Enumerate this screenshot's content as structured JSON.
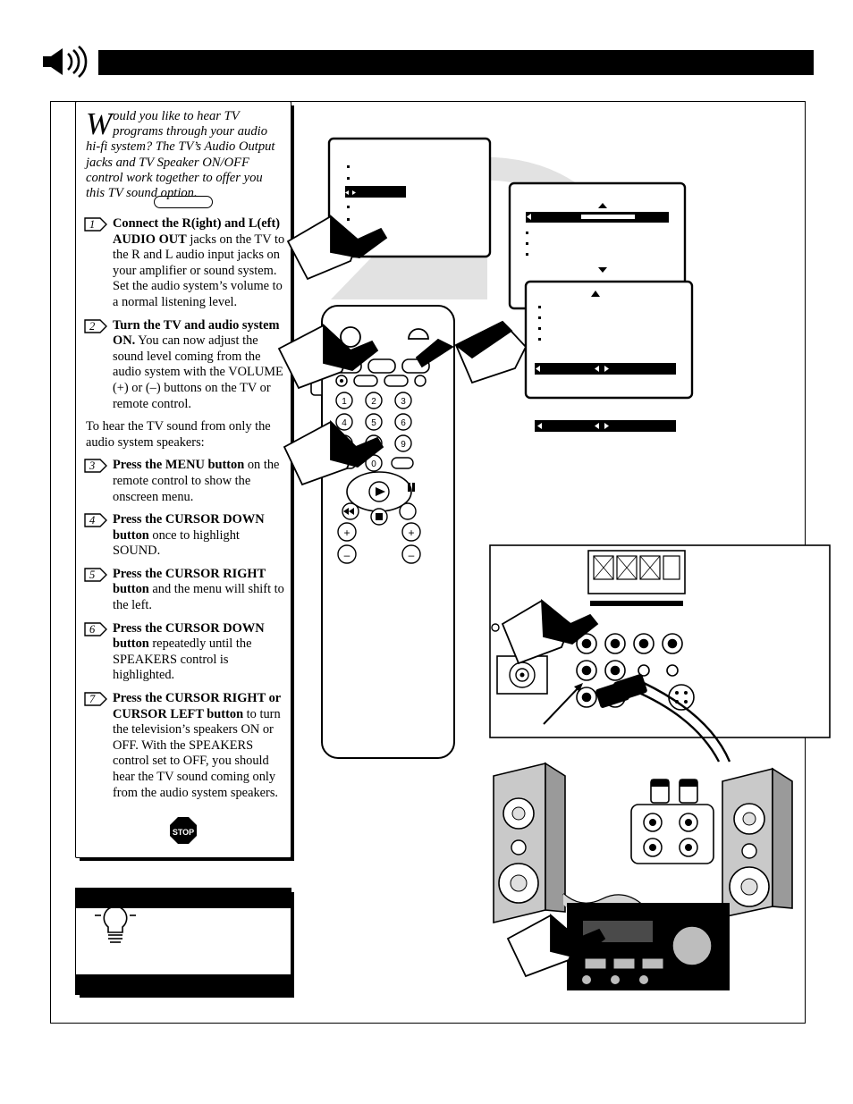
{
  "header": {
    "icon": "speaker-mute-icon",
    "bar_color": "#000000",
    "title": ""
  },
  "intro": {
    "dropcap": "W",
    "text": "ould you like to hear TV programs through your audio hi-fi system?  The TV’s Audio Output jacks and TV Speaker ON/OFF control work together to offer you this TV sound option."
  },
  "steps": [
    {
      "number": "1",
      "bold": "Connect the R(ight) and L(eft) AUDIO OUT",
      "rest": " jacks on the TV to the R and L audio input jacks on your amplifier or sound system.  Set the audio system’s volume to a normal listening level."
    },
    {
      "number": "2",
      "bold": "Turn the TV and audio system ON.",
      "rest": " You can now adjust the sound level coming from the audio system with the VOLUME (+) or (–) buttons on the TV or remote control."
    },
    {
      "number": "3",
      "bold": "Press the MENU button",
      "rest": " on the remote control to show the onscreen menu."
    },
    {
      "number": "4",
      "bold": "Press the CURSOR DOWN button",
      "rest": " once to highlight SOUND."
    },
    {
      "number": "5",
      "bold": "Press the CURSOR RIGHT button",
      "rest": " and the menu will shift to the left."
    },
    {
      "number": "6",
      "bold": "Press the CURSOR DOWN button",
      "rest": " repeatedly until the SPEAKERS control is highlighted."
    },
    {
      "number": "7",
      "bold": "Press the CURSOR RIGHT or CURSOR LEFT button",
      "rest": " to turn the television’s speakers ON or OFF. With the SPEAKERS control set to OFF, you should hear the TV sound coming only from the audio system speakers."
    }
  ],
  "interstitial_text": "To hear the TV sound from only the audio system speakers:",
  "stop_sign": {
    "label": "STOP"
  },
  "tip_box": {
    "icon": "lightbulb-icon",
    "header_text": "",
    "body_text": ""
  },
  "remote": {
    "keypad": [
      "1",
      "2",
      "3",
      "4",
      "5",
      "6",
      "7",
      "8",
      "9",
      "0"
    ],
    "transport_icons": [
      "play-icon",
      "pause-icon",
      "rewind-icon",
      "stop-icon",
      "record-icon"
    ],
    "plus_minus": [
      "+",
      "–",
      "+",
      "–"
    ]
  },
  "tv_menus": {
    "menu1": {
      "highlight_row": 2,
      "rows": 5
    },
    "menu2": {
      "highlight_row": 1,
      "rows": 7
    },
    "menu3": {
      "highlight_row": 6,
      "rows": 7
    },
    "status_bar": {
      "left_arrow": "◄",
      "right_arrow": "►"
    }
  },
  "colors": {
    "black": "#000000",
    "white": "#ffffff",
    "gray": "#c8c8c8",
    "shadow": "#d8d8d8"
  }
}
